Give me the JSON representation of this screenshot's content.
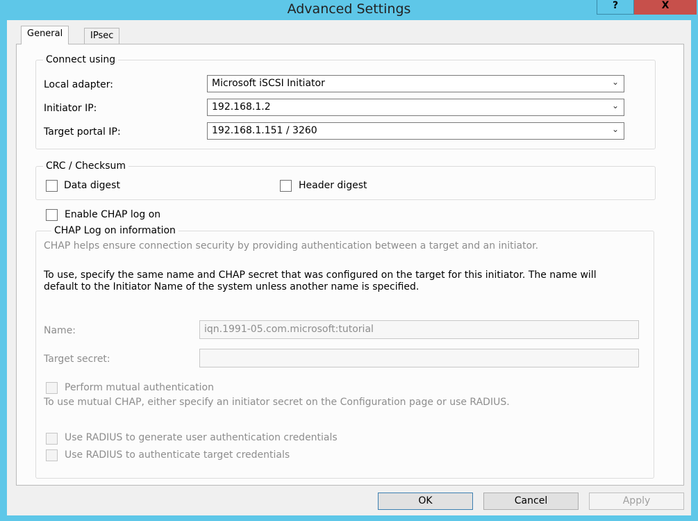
{
  "window": {
    "title": "Advanced Settings",
    "help": "?",
    "close": "X"
  },
  "tabs": [
    {
      "label": "General"
    },
    {
      "label": "IPsec"
    }
  ],
  "connect": {
    "legend": "Connect using",
    "local_adapter_label": "Local adapter:",
    "local_adapter": "Microsoft iSCSI Initiator",
    "initiator_ip_label": "Initiator IP:",
    "initiator_ip": "192.168.1.2",
    "target_portal_label": "Target portal IP:",
    "target_portal": "192.168.1.151 / 3260"
  },
  "crc": {
    "legend": "CRC / Checksum",
    "data_digest": "Data digest",
    "header_digest": "Header digest"
  },
  "chap": {
    "enable": "Enable CHAP log on",
    "legend": "CHAP Log on information",
    "desc": "CHAP helps ensure connection security by providing authentication between a target and an initiator.",
    "instructions": "To use, specify the same name and CHAP secret that was configured on the target for this initiator.  The name will default to the Initiator Name of the system unless another name is specified.",
    "name_label": "Name:",
    "name_value": "iqn.1991-05.com.microsoft:tutorial",
    "secret_label": "Target secret:",
    "secret_value": "",
    "mutual": "Perform mutual authentication",
    "mutual_desc": "To use mutual CHAP, either specify an initiator secret on the Configuration page or use RADIUS.",
    "radius_gen": "Use RADIUS to generate user authentication credentials",
    "radius_auth": "Use RADIUS to authenticate target credentials"
  },
  "buttons": {
    "ok": "OK",
    "cancel": "Cancel",
    "apply": "Apply"
  }
}
